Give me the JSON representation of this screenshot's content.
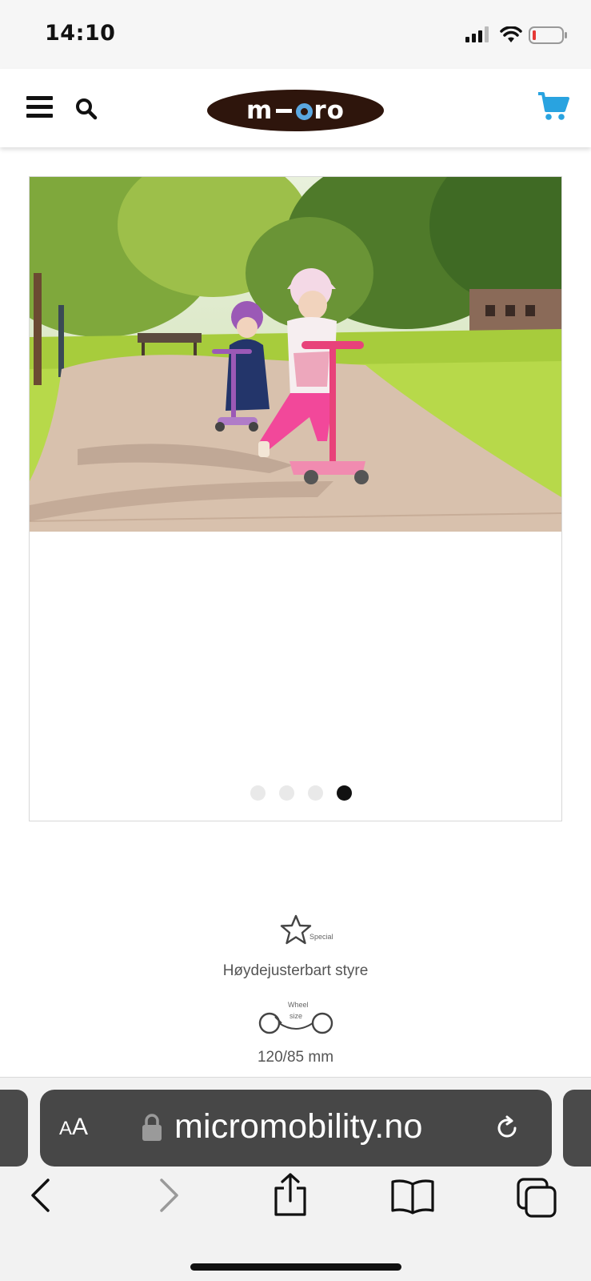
{
  "status_bar": {
    "time": "14:10"
  },
  "header": {
    "logo_text_left": "m",
    "logo_text_right": "ro",
    "logo_colors": {
      "background": "#2e150c",
      "accent": "#5aa7e0"
    },
    "cart_color": "#29a3e0"
  },
  "gallery": {
    "slide_count": 4,
    "active_index": 3
  },
  "specs": {
    "special_label": "Special",
    "special_text": "Høydejusterbart styre",
    "wheel_label_line1": "Wheel",
    "wheel_label_line2": "size",
    "wheel_text": "120/85 mm"
  },
  "browser": {
    "aa_label_big": "A",
    "aa_label_small": "A",
    "url": "micromobility.no"
  }
}
